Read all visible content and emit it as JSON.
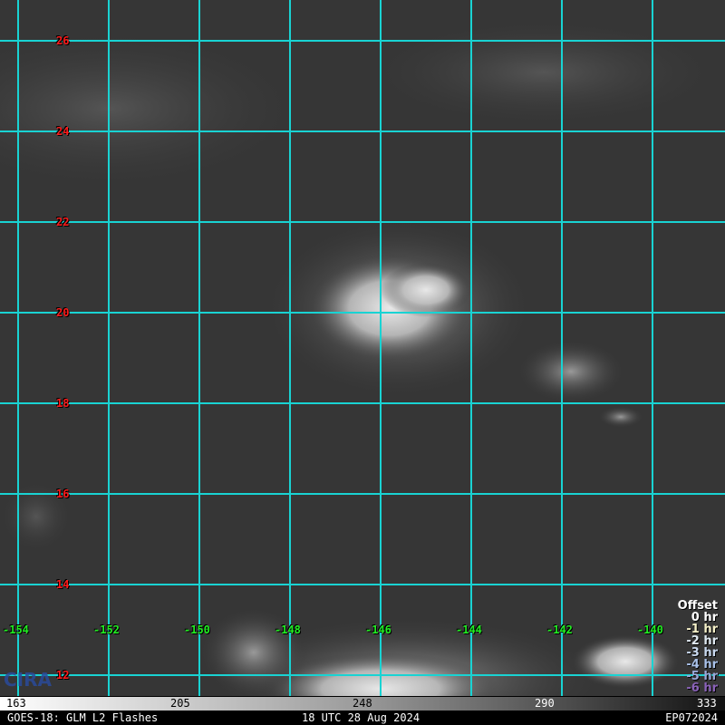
{
  "lat_labels": [
    "26",
    "24",
    "22",
    "20",
    "18",
    "16",
    "14",
    "12"
  ],
  "lon_labels": [
    "-154",
    "-152",
    "-150",
    "-148",
    "-146",
    "-144",
    "-142",
    "-140"
  ],
  "legend": {
    "title": "Offset",
    "items": [
      {
        "label": "0 hr",
        "color": "#ffffff"
      },
      {
        "label": "-1 hr",
        "color": "#f5f0c8"
      },
      {
        "label": "-2 hr",
        "color": "#dfe8f0"
      },
      {
        "label": "-3 hr",
        "color": "#c8d8ee"
      },
      {
        "label": "-4 hr",
        "color": "#a8c0e8"
      },
      {
        "label": "-5 hr",
        "color": "#9aa8d8"
      },
      {
        "label": "-6 hr",
        "color": "#8a62b8"
      }
    ]
  },
  "colorbar": [
    "163",
    "205",
    "248",
    "290",
    "333"
  ],
  "footer": {
    "left": "GOES-18: GLM L2 Flashes",
    "center": "18 UTC 28 Aug 2024",
    "right": "EP072024"
  },
  "logo": "CIRA",
  "colors": {
    "grid": "#19d3d3",
    "background": "#363636"
  }
}
